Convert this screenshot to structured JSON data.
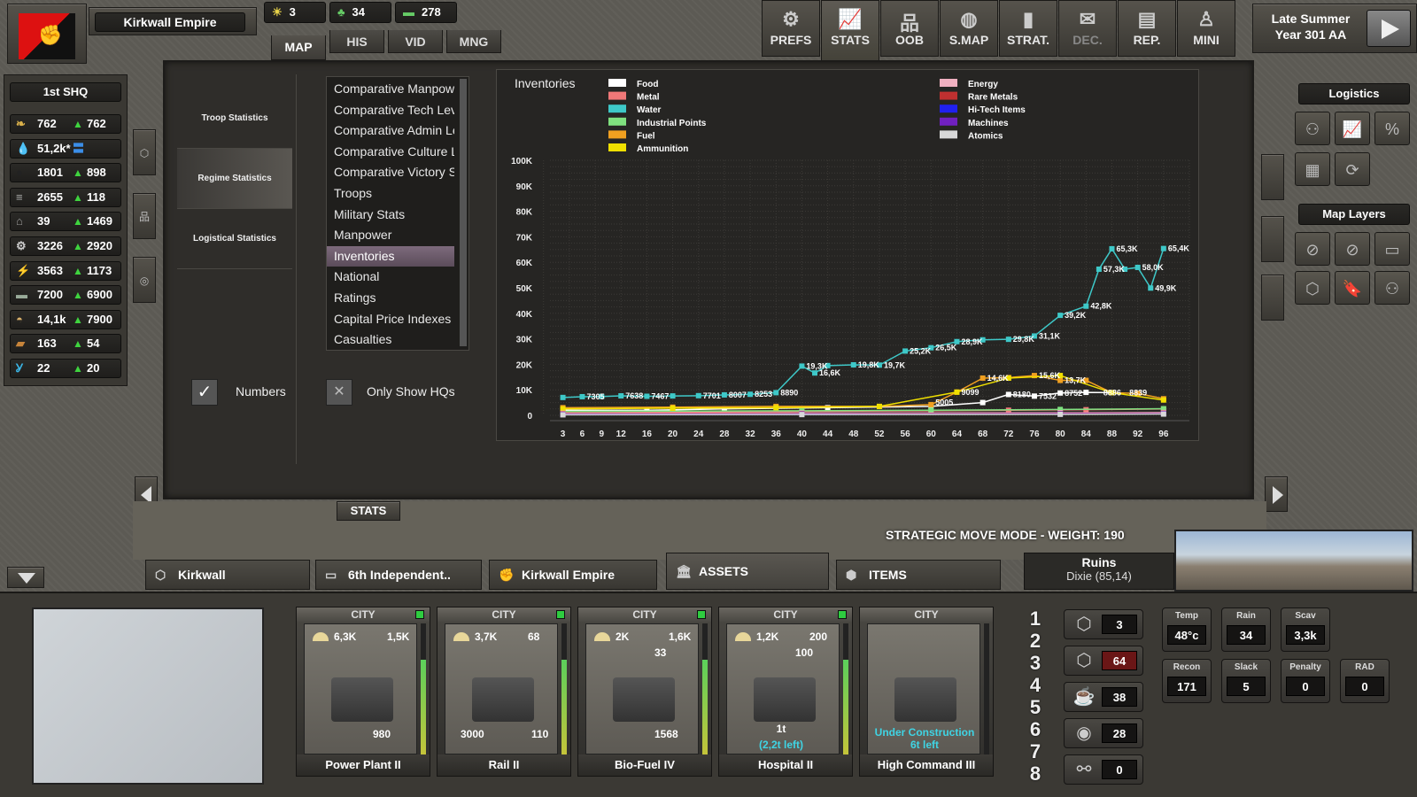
{
  "header": {
    "empire": "Kirkwall Empire",
    "res": [
      {
        "icon": "sun-icon",
        "v": "3"
      },
      {
        "icon": "people-icon",
        "v": "34"
      },
      {
        "icon": "money-icon",
        "v": "278"
      }
    ],
    "date_line1": "Late Summer",
    "date_line2": "Year 301 AA"
  },
  "tabs": [
    "MAP",
    "HIS",
    "VID",
    "MNG"
  ],
  "top_buttons": [
    {
      "label": "PREFS",
      "icon": "gear-icon",
      "glyph": "⚙"
    },
    {
      "label": "STATS",
      "icon": "chart-icon",
      "glyph": "📈"
    },
    {
      "label": "OOB",
      "icon": "hierarchy-icon",
      "glyph": "品"
    },
    {
      "label": "S.MAP",
      "icon": "globe-icon",
      "glyph": "◍"
    },
    {
      "label": "STRAT.",
      "icon": "card-icon",
      "glyph": "▮"
    },
    {
      "label": "DEC.",
      "icon": "envelope-icon",
      "glyph": "✉"
    },
    {
      "label": "REP.",
      "icon": "document-icon",
      "glyph": "▤"
    },
    {
      "label": "MINI",
      "icon": "person-icon",
      "glyph": "♙"
    }
  ],
  "hq": {
    "title": "1st SHQ",
    "rows": [
      {
        "icon": "wheat-icon",
        "g": "❧",
        "v": "762",
        "d": "762",
        "c": "#d9b04a"
      },
      {
        "icon": "water-icon",
        "g": "💧",
        "v": "51,2k*",
        "d": "",
        "c": "#4aa6e0"
      },
      {
        "icon": "oil-icon",
        "g": "●",
        "v": "1801",
        "d": "898",
        "c": "#222"
      },
      {
        "icon": "ammo-icon",
        "g": "≡",
        "v": "2655",
        "d": "118",
        "c": "#aaa"
      },
      {
        "icon": "metal-icon",
        "g": "⌂",
        "v": "39",
        "d": "1469",
        "c": "#999"
      },
      {
        "icon": "gear-icon",
        "g": "⚙",
        "v": "3226",
        "d": "2920",
        "c": "#ccc"
      },
      {
        "icon": "energy-icon",
        "g": "⚡",
        "v": "3563",
        "d": "1173",
        "c": "#3bb7e8"
      },
      {
        "icon": "money-icon",
        "g": "▬",
        "v": "7200",
        "d": "6900",
        "c": "#9a9"
      },
      {
        "icon": "helmet-icon",
        "g": "◓",
        "v": "14,1k",
        "d": "7900",
        "c": "#d9b06a"
      },
      {
        "icon": "ingot-icon",
        "g": "▰",
        "v": "163",
        "d": "54",
        "c": "#c7843a"
      },
      {
        "icon": "antenna-icon",
        "g": "Ỿ",
        "v": "22",
        "d": "20",
        "c": "#3bb7e8"
      }
    ]
  },
  "stats_side": [
    "Troop Statistics",
    "Regime Statistics",
    "Logistical Statistics"
  ],
  "menu": [
    "Comparative Manpower",
    "Comparative Tech Level",
    "Comparative Admin Level",
    "Comparative Culture Level",
    "Comparative Victory Score",
    "Troops",
    "Military Stats",
    "Manpower",
    "Inventories",
    "National",
    "Ratings",
    "Capital Price Indexes",
    "Casualties"
  ],
  "menu_selected": 8,
  "checks": {
    "numbers": "Numbers",
    "hq": "Only Show HQs"
  },
  "chart_data": {
    "type": "line",
    "title": "Inventories",
    "x_ticks": [
      "3",
      "6",
      "9",
      "12",
      "16",
      "20",
      "24",
      "28",
      "32",
      "36",
      "40",
      "44",
      "48",
      "52",
      "56",
      "60",
      "64",
      "68",
      "72",
      "76",
      "80",
      "84",
      "88",
      "92",
      "96"
    ],
    "y_ticks": [
      "100K",
      "90K",
      "80K",
      "70K",
      "60K",
      "50K",
      "40K",
      "30K",
      "20K",
      "10K",
      "0"
    ],
    "ylim": [
      0,
      100000
    ],
    "xlim": [
      1,
      100
    ],
    "legend_position": "top",
    "series": [
      {
        "name": "Food",
        "color": "#ffffff",
        "x": [
          3,
          16,
          28,
          44,
          60,
          68,
          72,
          76,
          80,
          84,
          88
        ],
        "y": [
          2000,
          2000,
          2500,
          3000,
          3500,
          5005,
          8180,
          7532,
          8752,
          9000,
          8886
        ]
      },
      {
        "name": "Metal",
        "color": "#f07878",
        "x": [
          3,
          20,
          40,
          60,
          72,
          84,
          96
        ],
        "y": [
          1000,
          1200,
          1500,
          1800,
          2000,
          2200,
          2500
        ]
      },
      {
        "name": "Water",
        "color": "#3ec8c8",
        "x": [
          3,
          6,
          9,
          12,
          16,
          20,
          24,
          28,
          32,
          36,
          40,
          42,
          44,
          48,
          52,
          56,
          60,
          64,
          68,
          72,
          76,
          80,
          84,
          86,
          88,
          90,
          92,
          94,
          96
        ],
        "y": [
          7000,
          7305,
          7400,
          7638,
          7467,
          7600,
          7701,
          8007,
          8253,
          8890,
          19300,
          16600,
          19500,
          19800,
          19700,
          25200,
          26500,
          28900,
          29600,
          29800,
          31100,
          39200,
          42800,
          57300,
          65300,
          57300,
          58000,
          49900,
          65400
        ]
      },
      {
        "name": "Industrial Points",
        "color": "#7fe07f",
        "x": [
          3,
          40,
          60,
          80,
          96
        ],
        "y": [
          1500,
          1800,
          2000,
          2300,
          2600
        ]
      },
      {
        "name": "Fuel",
        "color": "#f0a020",
        "x": [
          3,
          20,
          36,
          52,
          60,
          64,
          68,
          72,
          76,
          80,
          84,
          88,
          92,
          96
        ],
        "y": [
          3000,
          3200,
          3500,
          3500,
          4200,
          9099,
          14600,
          14800,
          15600,
          13700,
          13700,
          8886,
          8600,
          6500
        ]
      },
      {
        "name": "Ammunition",
        "color": "#f0e000",
        "x": [
          3,
          20,
          36,
          52,
          64,
          72,
          80,
          88,
          96
        ],
        "y": [
          2500,
          2800,
          3000,
          3500,
          9099,
          14600,
          15600,
          8886,
          6000
        ]
      },
      {
        "name": "Energy",
        "color": "#f0b0c0",
        "x": [
          3,
          40,
          80,
          96
        ],
        "y": [
          800,
          900,
          1000,
          1100
        ]
      },
      {
        "name": "Rare Metals",
        "color": "#c03030",
        "x": [
          3,
          40,
          80,
          96
        ],
        "y": [
          500,
          600,
          700,
          800
        ]
      },
      {
        "name": "Hi-Tech Items",
        "color": "#2020f0",
        "x": [
          3,
          40,
          80,
          96
        ],
        "y": [
          300,
          400,
          500,
          600
        ]
      },
      {
        "name": "Machines",
        "color": "#7020c0",
        "x": [
          3,
          40,
          80,
          96
        ],
        "y": [
          400,
          500,
          600,
          700
        ]
      },
      {
        "name": "Atomics",
        "color": "#d8d8d8",
        "x": [
          3,
          40,
          80,
          96
        ],
        "y": [
          200,
          300,
          400,
          500
        ]
      }
    ],
    "labels": [
      {
        "x": 6,
        "y": 7305,
        "t": "7305"
      },
      {
        "x": 12,
        "y": 7638,
        "t": "7638"
      },
      {
        "x": 16,
        "y": 7467,
        "t": "7467"
      },
      {
        "x": 24,
        "y": 7701,
        "t": "7701"
      },
      {
        "x": 28,
        "y": 8007,
        "t": "8007"
      },
      {
        "x": 32,
        "y": 8253,
        "t": "8253"
      },
      {
        "x": 36,
        "y": 8890,
        "t": "8890"
      },
      {
        "x": 40,
        "y": 19300,
        "t": "19,3K"
      },
      {
        "x": 42,
        "y": 16600,
        "t": "16,6K"
      },
      {
        "x": 48,
        "y": 19800,
        "t": "19,8K"
      },
      {
        "x": 52,
        "y": 19700,
        "t": "19,7K"
      },
      {
        "x": 56,
        "y": 25200,
        "t": "25,2K"
      },
      {
        "x": 60,
        "y": 26500,
        "t": "26,5K"
      },
      {
        "x": 64,
        "y": 28900,
        "t": "28,9K"
      },
      {
        "x": 72,
        "y": 29800,
        "t": "29,8K"
      },
      {
        "x": 76,
        "y": 31100,
        "t": "31,1K"
      },
      {
        "x": 80,
        "y": 39200,
        "t": "39,2K"
      },
      {
        "x": 84,
        "y": 42800,
        "t": "42,8K"
      },
      {
        "x": 86,
        "y": 57300,
        "t": "57,3K"
      },
      {
        "x": 88,
        "y": 65300,
        "t": "65,3K"
      },
      {
        "x": 92,
        "y": 58000,
        "t": "58,0K"
      },
      {
        "x": 94,
        "y": 49900,
        "t": "49,9K"
      },
      {
        "x": 96,
        "y": 65400,
        "t": "65,4K"
      },
      {
        "x": 64,
        "y": 9099,
        "t": "9099"
      },
      {
        "x": 68,
        "y": 14600,
        "t": "14,6K"
      },
      {
        "x": 76,
        "y": 15600,
        "t": "15,6K"
      },
      {
        "x": 80,
        "y": 13700,
        "t": "13,7K"
      },
      {
        "x": 72,
        "y": 8180,
        "t": "8180"
      },
      {
        "x": 76,
        "y": 7532,
        "t": "7532"
      },
      {
        "x": 80,
        "y": 8752,
        "t": "8752"
      },
      {
        "x": 86,
        "y": 8886,
        "t": "8886"
      },
      {
        "x": 90,
        "y": 8839,
        "t": "8839"
      },
      {
        "x": 60,
        "y": 5005,
        "t": "5005"
      }
    ]
  },
  "map": {
    "stats_tab": "STATS",
    "strategic": "STRATEGIC MOVE MODE - WEIGHT: 190",
    "hex_title": "Ruins",
    "hex_sub": "Dixie (85,14)"
  },
  "bottom_tabs": [
    {
      "label": "Kirkwall",
      "icon": "hex-icon",
      "g": "⬡"
    },
    {
      "label": "6th Independent..",
      "icon": "unit-icon",
      "g": "▭"
    },
    {
      "label": "Kirkwall Empire",
      "icon": "fist-icon",
      "g": "✊"
    },
    {
      "label": "ASSETS",
      "icon": "bank-icon",
      "g": "🏛"
    },
    {
      "label": "ITEMS",
      "icon": "box-icon",
      "g": "⬢"
    }
  ],
  "cards": [
    {
      "hdr": "CITY",
      "name": "Power Plant II",
      "s1": "6,3K",
      "s2": "1,5K",
      "s3": "980",
      "bar": 0.72
    },
    {
      "hdr": "CITY",
      "name": "Rail II",
      "s1": "3,7K",
      "s2": "68",
      "s3": "3000",
      "s4": "110",
      "bar": 0.72
    },
    {
      "hdr": "CITY",
      "name": "Bio-Fuel IV",
      "s1": "2K",
      "s2": "1,6K",
      "s2b": "33",
      "s3": "1568",
      "bar": 0.72
    },
    {
      "hdr": "CITY",
      "name": "Hospital II",
      "s1": "1,2K",
      "s2": "200",
      "s2b": "100",
      "s3": "1t",
      "s3b": "(2,2t left)",
      "bar": 0.72
    },
    {
      "hdr": "CITY",
      "name": "High Command III",
      "s3": "Under Construction",
      "s3b": "6t left",
      "bar": 0.0
    }
  ],
  "numbers": [
    "1",
    "2",
    "3",
    "4",
    "5",
    "6",
    "7",
    "8"
  ],
  "pills": [
    {
      "icon": "hex-icon",
      "g": "⬡",
      "v": "3"
    },
    {
      "icon": "hex-pair-icon",
      "g": "⬡",
      "v": "64"
    },
    {
      "icon": "mug-icon",
      "g": "☕",
      "v": "38"
    },
    {
      "icon": "lamp-icon",
      "g": "◉",
      "v": "28"
    },
    {
      "icon": "link-icon",
      "g": "⚯",
      "v": "0"
    }
  ],
  "env": [
    {
      "l": "Temp",
      "v": "48°c"
    },
    {
      "l": "Rain",
      "v": "34"
    },
    {
      "l": "Scav",
      "v": "3,3k"
    },
    {
      "l": "Recon",
      "v": "171"
    },
    {
      "l": "Slack",
      "v": "5"
    },
    {
      "l": "Penalty",
      "v": "0"
    },
    {
      "l": "RAD",
      "v": "0"
    }
  ],
  "right": {
    "logistics": "Logistics",
    "map_layers": "Map Layers"
  }
}
